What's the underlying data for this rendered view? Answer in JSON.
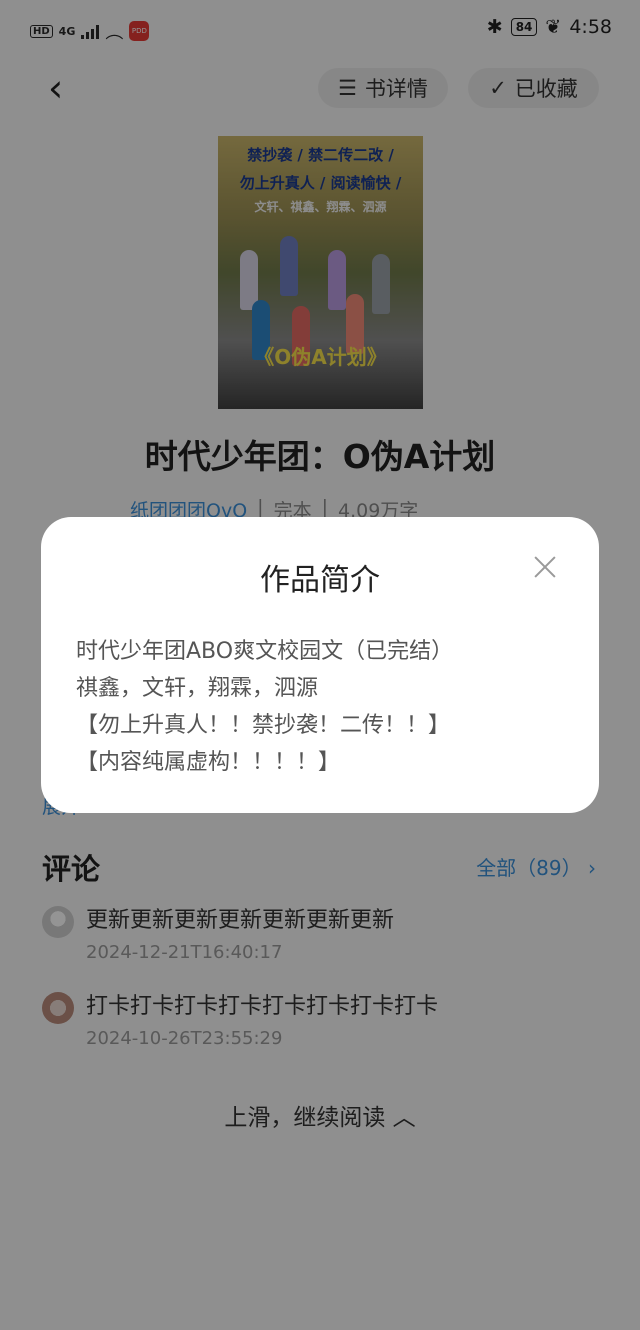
{
  "status_bar": {
    "hd": "HD",
    "signal": "4G",
    "app_badge": "PDD",
    "battery": "84",
    "time": "4:58"
  },
  "header": {
    "book_detail_label": "书详情",
    "favorited_label": "已收藏"
  },
  "cover": {
    "line1": "禁抄袭 / 禁二传二改 /",
    "line2": "勿上升真人 / 阅读愉快 /",
    "line3": "文轩、祺鑫、翔霖、泗源",
    "title": "《O伪A计划》"
  },
  "book": {
    "title": "时代少年团：O伪A计划",
    "author": "纸团团团OvO",
    "status": "完本",
    "word_count": "4.09万字"
  },
  "expand_label": "展开",
  "comments": {
    "title": "评论",
    "all_label": "全部（89）",
    "items": [
      {
        "text": "更新更新更新更新更新更新更新",
        "time": "2024-12-21T16:40:17"
      },
      {
        "text": "打卡打卡打卡打卡打卡打卡打卡打卡",
        "time": "2024-10-26T23:55:29"
      }
    ]
  },
  "swipe_label": "上滑，继续阅读 ︿",
  "modal": {
    "title": "作品简介",
    "lines": [
      "时代少年团ABO爽文校园文（已完结）",
      "祺鑫，文轩，翔霖，泗源",
      "【勿上升真人！！禁抄袭！二传！！】",
      "【内容纯属虚构！！！！】"
    ]
  }
}
